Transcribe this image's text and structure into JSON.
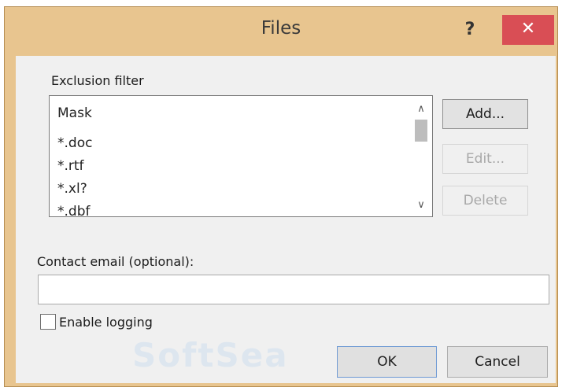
{
  "window": {
    "title": "Files",
    "help_label": "?",
    "close_label": "✕"
  },
  "exclusion": {
    "group_label": "Exclusion filter",
    "header": "Mask",
    "items": [
      "*.doc",
      "*.rtf",
      "*.xl?",
      "*.dbf"
    ],
    "scroll_up": "∧",
    "scroll_down": "∨"
  },
  "buttons": {
    "add": "Add...",
    "edit": "Edit...",
    "delete": "Delete",
    "ok": "OK",
    "cancel": "Cancel"
  },
  "email": {
    "label": "Contact email (optional):",
    "value": ""
  },
  "logging": {
    "label": "Enable logging",
    "checked": false
  },
  "watermark": "SoftSea",
  "colors": {
    "titlebar": "#e8c58f",
    "close_button": "#d94e55",
    "dialog_bg": "#f0f0f0"
  }
}
